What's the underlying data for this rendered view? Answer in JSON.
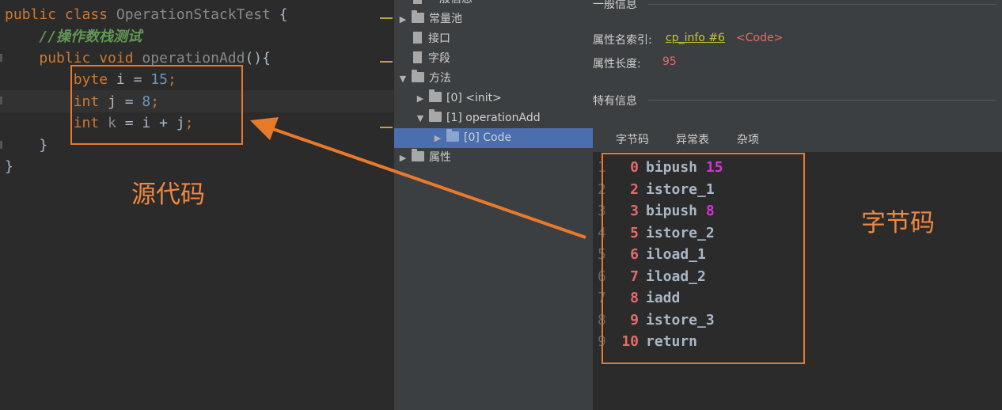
{
  "editor": {
    "lines": [
      {
        "parts": [
          {
            "t": "public ",
            "c": "kw"
          },
          {
            "t": "class ",
            "c": "kw"
          },
          {
            "t": "OperationStackTest ",
            "c": "grey"
          },
          {
            "t": "{",
            "c": "cls"
          }
        ]
      },
      {
        "parts": [
          {
            "t": "    ",
            "c": "cls"
          },
          {
            "t": "//操作数栈测试",
            "c": "cmt"
          }
        ]
      },
      {
        "parts": [
          {
            "t": "    ",
            "c": "cls"
          },
          {
            "t": "public ",
            "c": "kw"
          },
          {
            "t": "void ",
            "c": "kw"
          },
          {
            "t": "operationAdd",
            "c": "grey"
          },
          {
            "t": "(){",
            "c": "cls"
          }
        ]
      },
      {
        "parts": [
          {
            "t": "        ",
            "c": "cls"
          },
          {
            "t": "byte ",
            "c": "kw"
          },
          {
            "t": "i = ",
            "c": "cls"
          },
          {
            "t": "15",
            "c": "num"
          },
          {
            "t": ";",
            "c": "kw"
          }
        ]
      },
      {
        "parts": [
          {
            "t": "        ",
            "c": "cls"
          },
          {
            "t": "int ",
            "c": "kw"
          },
          {
            "t": "j = ",
            "c": "cls"
          },
          {
            "t": "8",
            "c": "num"
          },
          {
            "t": ";",
            "c": "kw"
          }
        ]
      },
      {
        "parts": [
          {
            "t": "        ",
            "c": "cls"
          },
          {
            "t": "int ",
            "c": "kw"
          },
          {
            "t": "k",
            "c": "grey"
          },
          {
            "t": " = i + j",
            "c": "cls"
          },
          {
            "t": ";",
            "c": "kw"
          }
        ]
      },
      {
        "parts": [
          {
            "t": "    }",
            "c": "cls"
          }
        ]
      },
      {
        "parts": [
          {
            "t": "}",
            "c": "cls"
          }
        ]
      }
    ],
    "annotation_label": "源代码"
  },
  "tree": {
    "items": [
      {
        "label": "一般信息",
        "depth": 0,
        "twisty": "",
        "icon": "file",
        "selected": false
      },
      {
        "label": "常量池",
        "depth": 0,
        "twisty": "▶",
        "icon": "folder",
        "selected": false
      },
      {
        "label": "接口",
        "depth": 0,
        "twisty": "",
        "icon": "file",
        "selected": false
      },
      {
        "label": "字段",
        "depth": 0,
        "twisty": "",
        "icon": "file",
        "selected": false
      },
      {
        "label": "方法",
        "depth": 0,
        "twisty": "▼",
        "icon": "folder",
        "selected": false
      },
      {
        "label": "[0] <init>",
        "depth": 1,
        "twisty": "▶",
        "icon": "folder",
        "selected": false
      },
      {
        "label": "[1] operationAdd",
        "depth": 1,
        "twisty": "▼",
        "icon": "folder",
        "selected": false
      },
      {
        "label": "[0] Code",
        "depth": 2,
        "twisty": "▶",
        "icon": "folder",
        "selected": true
      },
      {
        "label": "属性",
        "depth": 0,
        "twisty": "▶",
        "icon": "folder",
        "selected": false
      }
    ]
  },
  "details": {
    "general_title": "一般信息",
    "attr_name_label": "属性名索引:",
    "attr_name_link": "cp_info #6",
    "attr_name_value": "<Code>",
    "attr_len_label": "属性长度:",
    "attr_len_value": "95",
    "specific_title": "特有信息",
    "tabs": [
      "字节码",
      "异常表",
      "杂项"
    ],
    "bytecode": [
      {
        "ln": "1",
        "off": "0",
        "op": "bipush",
        "arg": "15"
      },
      {
        "ln": "2",
        "off": "2",
        "op": "istore_1",
        "arg": ""
      },
      {
        "ln": "3",
        "off": "3",
        "op": "bipush",
        "arg": "8"
      },
      {
        "ln": "4",
        "off": "5",
        "op": "istore_2",
        "arg": ""
      },
      {
        "ln": "5",
        "off": "6",
        "op": "iload_1",
        "arg": ""
      },
      {
        "ln": "6",
        "off": "7",
        "op": "iload_2",
        "arg": ""
      },
      {
        "ln": "7",
        "off": "8",
        "op": "iadd",
        "arg": ""
      },
      {
        "ln": "8",
        "off": "9",
        "op": "istore_3",
        "arg": ""
      },
      {
        "ln": "9",
        "off": "10",
        "op": "return",
        "arg": ""
      }
    ],
    "annotation_label": "字节码"
  },
  "colors": {
    "accent_orange": "#e87a2c",
    "selection": "#4b6eaf"
  }
}
